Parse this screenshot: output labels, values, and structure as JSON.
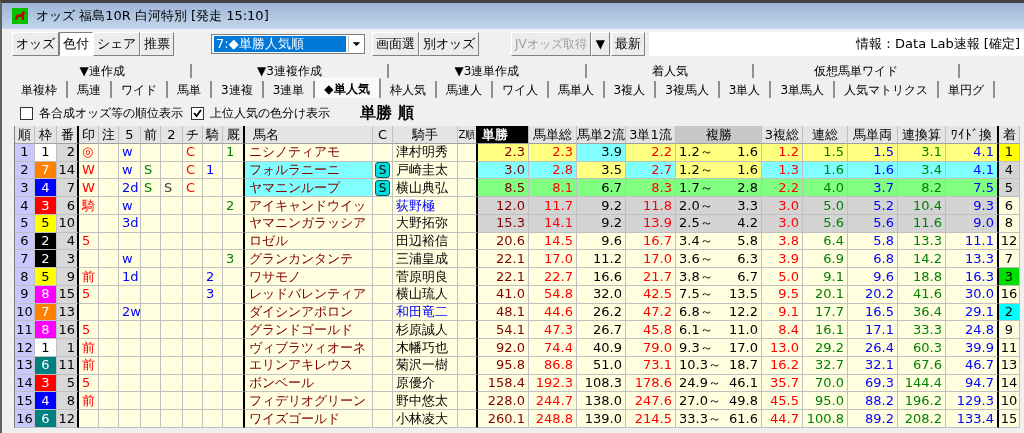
{
  "window": {
    "title": "オッズ 福島10R 白河特別 [発走 15:10]"
  },
  "toolbar": {
    "mode_buttons": [
      {
        "label": "オッズ",
        "selected": false
      },
      {
        "label": "色付",
        "selected": true
      },
      {
        "label": "シェア",
        "selected": false
      },
      {
        "label": "推票",
        "selected": false
      }
    ],
    "view_select": {
      "value": "7:◆単勝人気順"
    },
    "buttons": [
      {
        "label": "画面選",
        "disabled": false
      },
      {
        "label": "別オッズ",
        "disabled": false
      }
    ],
    "fetch_button": {
      "label": "JVオッズ取得",
      "disabled": true
    },
    "fetch_menu": "▼",
    "refresh_button": "最新",
    "info": "情報：Data Lab速報 [確定]"
  },
  "tab_groups": [
    "▼連作成",
    "▼3連複作成",
    "▼3連単作成",
    "着人気",
    "仮想馬単ワイド"
  ],
  "tabs": [
    {
      "label": "単複枠",
      "selected": false
    },
    {
      "label": "馬連",
      "selected": false
    },
    {
      "label": "ワイド",
      "selected": false
    },
    {
      "label": "馬単",
      "selected": false
    },
    {
      "label": "3連複",
      "selected": false
    },
    {
      "label": "3連単",
      "selected": false
    },
    {
      "label": "◆単人気",
      "selected": true
    },
    {
      "label": "枠人気",
      "selected": false
    },
    {
      "label": "馬連人",
      "selected": false
    },
    {
      "label": "ワイ人",
      "selected": false
    },
    {
      "label": "馬単人",
      "selected": false
    },
    {
      "label": "3複人",
      "selected": false
    },
    {
      "label": "3複馬人",
      "selected": false
    },
    {
      "label": "3単人",
      "selected": false
    },
    {
      "label": "3単馬人",
      "selected": false
    },
    {
      "label": "人気マトリクス",
      "selected": false
    },
    {
      "label": "単円グ",
      "selected": false
    }
  ],
  "options": [
    {
      "label": "各合成オッズ等の順位表示",
      "checked": false
    },
    {
      "label": "上位人気の色分け表示",
      "checked": true
    }
  ],
  "sort_title": "単勝 順",
  "table": {
    "columns": [
      {
        "label": "順",
        "kind": "rank"
      },
      {
        "label": "枠",
        "kind": "frame"
      },
      {
        "label": "番",
        "kind": "number"
      },
      {
        "label": "印",
        "kind": "mark"
      },
      {
        "label": "注",
        "kind": "note"
      },
      {
        "label": "5",
        "kind": "c5"
      },
      {
        "label": "前",
        "kind": "mae"
      },
      {
        "label": "2",
        "kind": "c2"
      },
      {
        "label": "チ",
        "kind": "chi"
      },
      {
        "label": "騎",
        "kind": "ki"
      },
      {
        "label": "厩",
        "kind": "kyu"
      },
      {
        "label": "馬名",
        "kind": "name"
      },
      {
        "label": "C",
        "kind": "badge"
      },
      {
        "label": "騎手",
        "kind": "jockey"
      },
      {
        "label": "Z順",
        "kind": "zrank"
      },
      {
        "label": "単勝",
        "kind": "odds",
        "selected": true
      },
      {
        "label": "馬単総",
        "kind": "odds",
        "selected": false
      },
      {
        "label": "馬単2流",
        "kind": "odds",
        "selected": false
      },
      {
        "label": "3単1流",
        "kind": "odds",
        "selected": false
      },
      {
        "label": "複勝",
        "kind": "place",
        "selected": false
      },
      {
        "label": "3複総",
        "kind": "odds",
        "selected": false
      },
      {
        "label": "連総",
        "kind": "odds",
        "selected": false
      },
      {
        "label": "馬単両",
        "kind": "odds",
        "selected": false
      },
      {
        "label": "連換算",
        "kind": "odds",
        "selected": false
      },
      {
        "label": "ﾜｲﾄﾞ換",
        "kind": "odds",
        "selected": false
      },
      {
        "label": "着",
        "kind": "finish"
      }
    ],
    "rows": [
      {
        "rank": "1",
        "frame": {
          "text": "1",
          "color": "#ffffff"
        },
        "number": "2",
        "mark": "◎",
        "c5": "w",
        "chi": "C",
        "kyu": "1",
        "name": {
          "text": "ニシノティアモ"
        },
        "jockey": "津村明秀",
        "jockey_highlight": false,
        "band": {
          "color": "#ffff80"
        },
        "odds": [
          {
            "text": "2.3"
          },
          {
            "text": "2.3"
          },
          {
            "text": "3.9",
            "color": "#80ffff"
          },
          {
            "text": "2.2"
          },
          {
            "low": "1.2～",
            "high": "1.6"
          },
          {
            "text": "1.2"
          },
          {
            "text": "1.5"
          },
          {
            "text": "1.5"
          },
          {
            "text": "3.1"
          },
          {
            "text": "4.1"
          }
        ],
        "finish": {
          "text": "1",
          "color": "#ffff00"
        }
      },
      {
        "rank": "2",
        "frame": {
          "text": "7",
          "color": "#ff8000"
        },
        "number": "14",
        "mark": "W",
        "c5": "w",
        "mae": "S",
        "chi": "C",
        "ki": "1",
        "name": {
          "text": "フォルラニーニ",
          "color": "#80ffff"
        },
        "badge": "S",
        "jockey": "戸崎圭太",
        "jockey_highlight": false,
        "band": {
          "color": "#80ffff"
        },
        "odds": [
          {
            "text": "3.0"
          },
          {
            "text": "2.8"
          },
          {
            "text": "3.5",
            "color": "#ffff80"
          },
          {
            "text": "2.7"
          },
          {
            "low": "1.2～",
            "high": "1.6",
            "color": "#ffff80"
          },
          {
            "text": "1.3"
          },
          {
            "text": "1.6"
          },
          {
            "text": "1.6"
          },
          {
            "text": "3.4"
          },
          {
            "text": "4.1"
          }
        ],
        "finish": {
          "text": "4",
          "color": "#d4d4d4"
        }
      },
      {
        "rank": "3",
        "frame": {
          "text": "4",
          "color": "#0000ff"
        },
        "number": "7",
        "mark": "W",
        "c5": "2d",
        "mae": "S",
        "c2": "S",
        "chi": "C",
        "name": {
          "text": "ヤマニンループ",
          "color": "#80ffff"
        },
        "badge": "S",
        "jockey": "横山典弘",
        "jockey_highlight": false,
        "band": {
          "color": "#80ff80"
        },
        "odds": [
          {
            "text": "8.5"
          },
          {
            "text": "8.1"
          },
          {
            "text": "6.7"
          },
          {
            "text": "8.3"
          },
          {
            "low": "1.7～",
            "high": "2.8"
          },
          {
            "text": "2.2"
          },
          {
            "text": "4.0"
          },
          {
            "text": "3.7"
          },
          {
            "text": "8.2"
          },
          {
            "text": "7.5"
          }
        ],
        "finish": {
          "text": "5",
          "color": "#d4d4d4"
        }
      },
      {
        "rank": "4",
        "frame": {
          "text": "3",
          "color": "#ff0000"
        },
        "number": "6",
        "mark": "騎",
        "c5": "w",
        "kyu": "2",
        "name": {
          "text": "アイキャンドウイッ"
        },
        "jockey": "荻野極",
        "jockey_highlight": true,
        "band": {
          "color": "#d4d4d4"
        },
        "odds": [
          {
            "text": "12.0"
          },
          {
            "text": "11.7"
          },
          {
            "text": "9.2"
          },
          {
            "text": "11.8"
          },
          {
            "low": "2.0～",
            "high": "3.3"
          },
          {
            "text": "3.0"
          },
          {
            "text": "5.0"
          },
          {
            "text": "5.2"
          },
          {
            "text": "10.4"
          },
          {
            "text": "9.3"
          }
        ],
        "finish": {
          "text": "6",
          "color": "#ffffe0"
        }
      },
      {
        "rank": "5",
        "frame": {
          "text": "5",
          "color": "#ffff00"
        },
        "number": "10",
        "c5": "3d",
        "name": {
          "text": "ヤマニンガラッシア"
        },
        "jockey": "大野拓弥",
        "jockey_highlight": false,
        "band": {
          "color": "#d4d4d4"
        },
        "odds": [
          {
            "text": "15.3"
          },
          {
            "text": "14.1"
          },
          {
            "text": "9.2"
          },
          {
            "text": "13.9"
          },
          {
            "low": "2.5～",
            "high": "4.2"
          },
          {
            "text": "3.0"
          },
          {
            "text": "5.6"
          },
          {
            "text": "5.6"
          },
          {
            "text": "11.6"
          },
          {
            "text": "9.0"
          }
        ],
        "finish": {
          "text": "8",
          "color": "#ffffe0"
        }
      },
      {
        "rank": "6",
        "frame": {
          "text": "2",
          "color": "#000000"
        },
        "number": "4",
        "mark": "5",
        "name": {
          "text": "ロゼル"
        },
        "jockey": "田辺裕信",
        "jockey_highlight": false,
        "odds": [
          {
            "text": "20.6"
          },
          {
            "text": "14.5"
          },
          {
            "text": "9.6"
          },
          {
            "text": "16.7"
          },
          {
            "low": "3.4～",
            "high": "5.8"
          },
          {
            "text": "3.8"
          },
          {
            "text": "6.4"
          },
          {
            "text": "5.8"
          },
          {
            "text": "13.3"
          },
          {
            "text": "11.1"
          }
        ],
        "finish": {
          "text": "12",
          "color": "#ffffe0"
        }
      },
      {
        "rank": "7",
        "frame": {
          "text": "2",
          "color": "#000000"
        },
        "number": "3",
        "c5": "w",
        "kyu": "3",
        "name": {
          "text": "グランカンタンテ"
        },
        "jockey": "三浦皇成",
        "jockey_highlight": false,
        "odds": [
          {
            "text": "22.1"
          },
          {
            "text": "17.0"
          },
          {
            "text": "11.2"
          },
          {
            "text": "17.0"
          },
          {
            "low": "3.6～",
            "high": "6.3"
          },
          {
            "text": "3.9"
          },
          {
            "text": "6.9"
          },
          {
            "text": "6.8"
          },
          {
            "text": "14.2"
          },
          {
            "text": "13.3"
          }
        ],
        "finish": {
          "text": "7",
          "color": "#ffffe0"
        }
      },
      {
        "rank": "8",
        "frame": {
          "text": "5",
          "color": "#ffff00"
        },
        "number": "9",
        "mark": "前",
        "c5": "1d",
        "ki": "2",
        "name": {
          "text": "ワサモノ"
        },
        "jockey": "菅原明良",
        "jockey_highlight": false,
        "odds": [
          {
            "text": "22.1"
          },
          {
            "text": "22.7"
          },
          {
            "text": "16.6"
          },
          {
            "text": "21.7"
          },
          {
            "low": "3.8～",
            "high": "6.7"
          },
          {
            "text": "5.0"
          },
          {
            "text": "9.1"
          },
          {
            "text": "9.6"
          },
          {
            "text": "18.8"
          },
          {
            "text": "16.3"
          }
        ],
        "finish": {
          "text": "3",
          "color": "#00e000"
        }
      },
      {
        "rank": "9",
        "frame": {
          "text": "8",
          "color": "#ff00ff"
        },
        "number": "15",
        "mark": "5",
        "ki": "3",
        "name": {
          "text": "レッドバレンティア"
        },
        "jockey": "横山琉人",
        "jockey_highlight": false,
        "odds": [
          {
            "text": "41.0"
          },
          {
            "text": "54.8"
          },
          {
            "text": "32.0"
          },
          {
            "text": "42.5"
          },
          {
            "low": "7.5～",
            "high": "13.5"
          },
          {
            "text": "9.5"
          },
          {
            "text": "20.1"
          },
          {
            "text": "20.2"
          },
          {
            "text": "41.6"
          },
          {
            "text": "30.0"
          }
        ],
        "finish": {
          "text": "16",
          "color": "#ffffe0"
        }
      },
      {
        "rank": "10",
        "frame": {
          "text": "7",
          "color": "#ff8000"
        },
        "number": "13",
        "c5": "2w",
        "name": {
          "text": "ダイシンアポロン"
        },
        "jockey": "和田竜二",
        "jockey_highlight": true,
        "odds": [
          {
            "text": "48.1"
          },
          {
            "text": "44.6"
          },
          {
            "text": "26.2"
          },
          {
            "text": "47.2"
          },
          {
            "low": "6.8～",
            "high": "12.2"
          },
          {
            "text": "9.1"
          },
          {
            "text": "17.7"
          },
          {
            "text": "16.5"
          },
          {
            "text": "36.4"
          },
          {
            "text": "29.1"
          }
        ],
        "finish": {
          "text": "2",
          "color": "#00ffff"
        }
      },
      {
        "rank": "11",
        "frame": {
          "text": "8",
          "color": "#ff00ff"
        },
        "number": "16",
        "mark": "5",
        "name": {
          "text": "グランドゴールド"
        },
        "jockey": "杉原誠人",
        "jockey_highlight": false,
        "odds": [
          {
            "text": "54.1"
          },
          {
            "text": "47.3"
          },
          {
            "text": "26.7"
          },
          {
            "text": "45.8"
          },
          {
            "low": "6.1～",
            "high": "11.0"
          },
          {
            "text": "8.4"
          },
          {
            "text": "16.1"
          },
          {
            "text": "17.1"
          },
          {
            "text": "33.3"
          },
          {
            "text": "24.8"
          }
        ],
        "finish": {
          "text": "9",
          "color": "#ffffe0"
        }
      },
      {
        "rank": "12",
        "frame": {
          "text": "1",
          "color": "#ffffff"
        },
        "number": "1",
        "mark": "前",
        "name": {
          "text": "ヴィブラツィオーネ"
        },
        "jockey": "木幡巧也",
        "jockey_highlight": false,
        "odds": [
          {
            "text": "92.0"
          },
          {
            "text": "74.4"
          },
          {
            "text": "40.9"
          },
          {
            "text": "79.0"
          },
          {
            "low": "9.3～",
            "high": "17.0"
          },
          {
            "text": "13.0"
          },
          {
            "text": "29.2"
          },
          {
            "text": "26.4"
          },
          {
            "text": "60.3"
          },
          {
            "text": "39.9"
          }
        ],
        "finish": {
          "text": "11",
          "color": "#ffffe0"
        }
      },
      {
        "rank": "13",
        "frame": {
          "text": "6",
          "color": "#008080"
        },
        "number": "11",
        "mark": "前",
        "name": {
          "text": "エリンアキレウス"
        },
        "jockey": "菊沢一樹",
        "jockey_highlight": false,
        "odds": [
          {
            "text": "95.8"
          },
          {
            "text": "86.8"
          },
          {
            "text": "51.0"
          },
          {
            "text": "73.1"
          },
          {
            "low": "10.3～",
            "high": "18.7"
          },
          {
            "text": "16.2"
          },
          {
            "text": "32.7"
          },
          {
            "text": "32.1"
          },
          {
            "text": "67.6"
          },
          {
            "text": "46.7"
          }
        ],
        "finish": {
          "text": "13",
          "color": "#ffffe0"
        }
      },
      {
        "rank": "14",
        "frame": {
          "text": "3",
          "color": "#ff0000"
        },
        "number": "5",
        "mark": "5",
        "name": {
          "text": "ボンベール"
        },
        "jockey": "原優介",
        "jockey_highlight": false,
        "odds": [
          {
            "text": "158.4"
          },
          {
            "text": "192.3"
          },
          {
            "text": "108.3"
          },
          {
            "text": "178.6"
          },
          {
            "low": "24.9～",
            "high": "46.1"
          },
          {
            "text": "35.7"
          },
          {
            "text": "70.0"
          },
          {
            "text": "69.3"
          },
          {
            "text": "144.4"
          },
          {
            "text": "94.7"
          }
        ],
        "finish": {
          "text": "14",
          "color": "#ffffe0"
        }
      },
      {
        "rank": "15",
        "frame": {
          "text": "4",
          "color": "#0000ff"
        },
        "number": "8",
        "mark": "前",
        "name": {
          "text": "フィデリオグリーン"
        },
        "jockey": "野中悠太",
        "jockey_highlight": false,
        "odds": [
          {
            "text": "228.0"
          },
          {
            "text": "244.7"
          },
          {
            "text": "138.0"
          },
          {
            "text": "247.6"
          },
          {
            "low": "27.0～",
            "high": "49.8"
          },
          {
            "text": "45.5"
          },
          {
            "text": "95.0"
          },
          {
            "text": "88.2"
          },
          {
            "text": "196.2"
          },
          {
            "text": "129.3"
          }
        ],
        "finish": {
          "text": "10",
          "color": "#ffffe0"
        }
      },
      {
        "rank": "16",
        "frame": {
          "text": "6",
          "color": "#008080"
        },
        "number": "12",
        "name": {
          "text": "ワイズゴールド"
        },
        "jockey": "小林凌大",
        "jockey_highlight": false,
        "odds": [
          {
            "text": "260.1"
          },
          {
            "text": "248.8"
          },
          {
            "text": "139.0"
          },
          {
            "text": "214.5"
          },
          {
            "low": "33.3～",
            "high": "61.6"
          },
          {
            "text": "44.7"
          },
          {
            "text": "100.8"
          },
          {
            "text": "89.2"
          },
          {
            "text": "208.2"
          },
          {
            "text": "133.4"
          }
        ],
        "finish": {
          "text": "15",
          "color": "#ffffe0"
        }
      }
    ]
  }
}
